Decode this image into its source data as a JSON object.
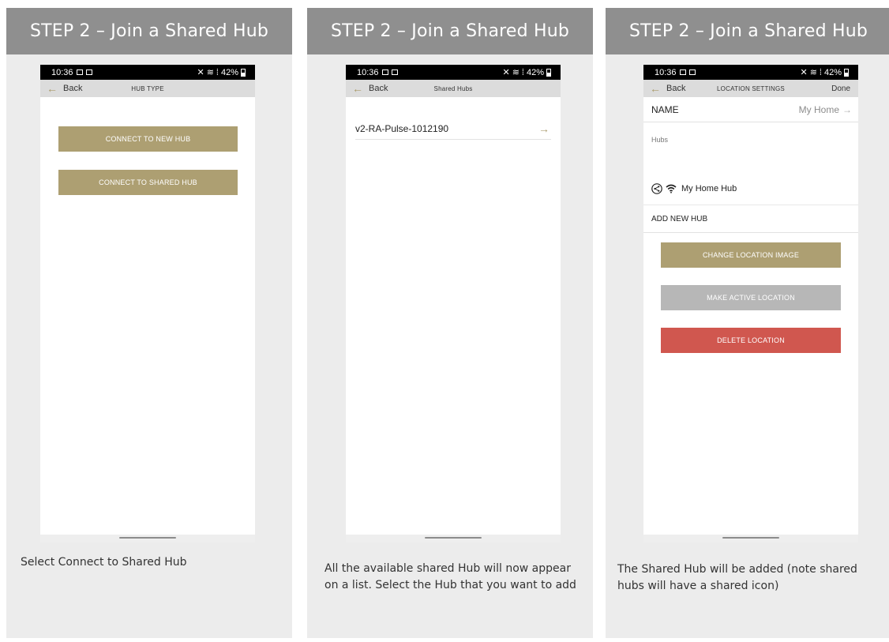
{
  "panels": [
    {
      "header": "STEP 2 – Join a Shared Hub",
      "phone": {
        "status_time": "10:36",
        "status_right": "42%",
        "back_label": "Back",
        "nav_title": "HUB TYPE",
        "buttons": [
          "CONNECT TO NEW HUB",
          "CONNECT TO SHARED HUB"
        ]
      },
      "caption": "Select Connect to Shared Hub"
    },
    {
      "header": "STEP 2 – Join a Shared Hub",
      "phone": {
        "status_time": "10:36",
        "status_right": "42%",
        "back_label": "Back",
        "nav_title": "Shared Hubs",
        "hub_name": "v2-RA-Pulse-1012190",
        "hub_arrow": "→"
      },
      "caption": "All the available shared Hub will now appear on a list. Select the Hub that you want to add"
    },
    {
      "header": "STEP 2 – Join a Shared Hub",
      "phone": {
        "status_time": "10:36",
        "status_right": "42%",
        "back_label": "Back",
        "nav_title": "LOCATION SETTINGS",
        "nav_done": "Done",
        "name_label": "NAME",
        "name_value": "My Home",
        "name_arrow": "→",
        "hubs_label": "Hubs",
        "hub_name": "My Home Hub",
        "add_hub_label": "ADD NEW HUB",
        "buttons": [
          {
            "label": "CHANGE LOCATION IMAGE",
            "color": "#ad9f72"
          },
          {
            "label": "MAKE ACTIVE LOCATION",
            "color": "#b7b7b7"
          },
          {
            "label": "DELETE LOCATION",
            "color": "#d0574f"
          }
        ]
      },
      "caption": "The Shared Hub will be added (note shared hubs will have a shared icon)"
    }
  ],
  "colors": {
    "header_bg": "#8f8f8f",
    "panel_bg": "#ececec",
    "accent_gold": "#ad9f72",
    "delete_red": "#d0574f"
  }
}
